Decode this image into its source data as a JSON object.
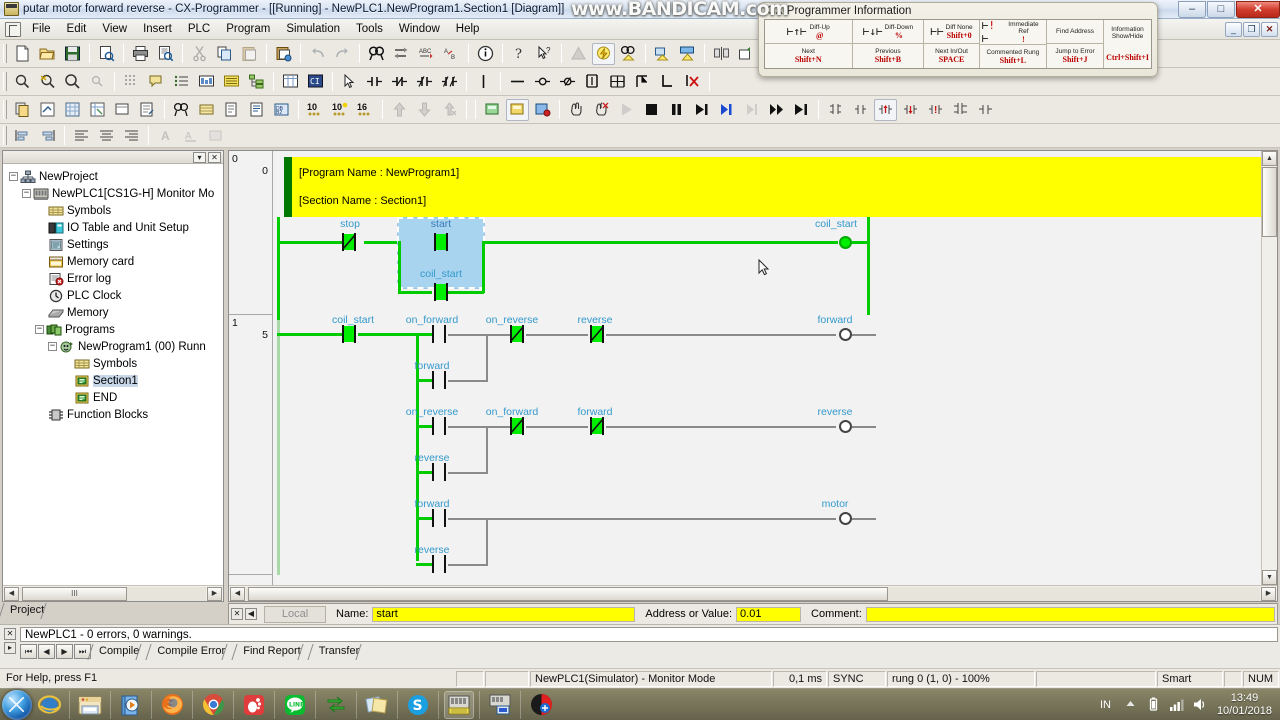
{
  "window": {
    "title": "putar motor forward reverse - CX-Programmer - [[Running] - NewPLC1.NewProgram1.Section1 [Diagram]]",
    "watermark": "www.BANDICAM.com",
    "minimize": "–",
    "maximize": "□",
    "close": "✕",
    "mdi_minimize": "_",
    "mdi_restore": "❐",
    "mdi_close": "✕"
  },
  "menu": {
    "items": [
      "File",
      "Edit",
      "View",
      "Insert",
      "PLC",
      "Program",
      "Simulation",
      "Tools",
      "Window",
      "Help"
    ]
  },
  "cx_info": {
    "title": "CX-Programmer Information",
    "top_row": [
      {
        "label": "Diff-Up",
        "key": "@"
      },
      {
        "label": "Diff-Down",
        "key": "%"
      },
      {
        "label": "Diff None",
        "key": "Shift+0"
      },
      {
        "label": "Immediate Ref",
        "key": "!"
      }
    ],
    "find_address_label": "Find Address",
    "bottom_row": [
      {
        "label": "Next",
        "key": "Shift+N"
      },
      {
        "label": "Previous",
        "key": "Shift+B"
      },
      {
        "label": "Next In/Out",
        "key": "SPACE"
      },
      {
        "label": "Commented Rung",
        "key": "Shift+L"
      },
      {
        "label": "Jump to Error",
        "key": "Shift+J"
      }
    ],
    "info_label_1": "Information",
    "info_label_2": "Show/Hide",
    "info_key": "Ctrl+Shift+I"
  },
  "project_tree": {
    "caption_buttons": [
      "▾",
      "✕"
    ],
    "nodes": [
      {
        "label": "NewProject",
        "depth": 0,
        "expander": "−",
        "icon": "project-icon",
        "selected": false
      },
      {
        "label": "NewPLC1[CS1G-H] Monitor Mo",
        "depth": 1,
        "expander": "−",
        "icon": "plc-icon",
        "selected": false
      },
      {
        "label": "Symbols",
        "depth": 2,
        "expander": "",
        "icon": "symbols-icon",
        "selected": false
      },
      {
        "label": "IO Table and Unit Setup",
        "depth": 2,
        "expander": "",
        "icon": "iotable-icon",
        "selected": false
      },
      {
        "label": "Settings",
        "depth": 2,
        "expander": "",
        "icon": "settings-icon",
        "selected": false
      },
      {
        "label": "Memory card",
        "depth": 2,
        "expander": "",
        "icon": "memorycard-icon",
        "selected": false
      },
      {
        "label": "Error log",
        "depth": 2,
        "expander": "",
        "icon": "errorlog-icon",
        "selected": false
      },
      {
        "label": "PLC Clock",
        "depth": 2,
        "expander": "",
        "icon": "clock-icon",
        "selected": false
      },
      {
        "label": "Memory",
        "depth": 2,
        "expander": "",
        "icon": "memory-icon",
        "selected": false
      },
      {
        "label": "Programs",
        "depth": 2,
        "expander": "−",
        "icon": "programs-icon",
        "selected": false
      },
      {
        "label": "NewProgram1 (00) Runn",
        "depth": 3,
        "expander": "−",
        "icon": "program-icon",
        "selected": false
      },
      {
        "label": "Symbols",
        "depth": 4,
        "expander": "",
        "icon": "symbols-icon",
        "selected": false
      },
      {
        "label": "Section1",
        "depth": 4,
        "expander": "",
        "icon": "section-icon",
        "selected": true
      },
      {
        "label": "END",
        "depth": 4,
        "expander": "",
        "icon": "section-icon",
        "selected": false
      },
      {
        "label": "Function Blocks",
        "depth": 2,
        "expander": "",
        "icon": "functionblock-icon",
        "selected": false
      }
    ],
    "tab_label": "Project",
    "scroll_thumb": "III"
  },
  "ladder": {
    "rungs": [
      {
        "number": "0",
        "address": "0"
      },
      {
        "number": "1",
        "address": "5"
      }
    ],
    "comment_lines": [
      "[Program Name : NewProgram1]",
      "[Section Name : Section1]"
    ],
    "rung0": {
      "contacts": [
        {
          "name": "stop",
          "type": "nc",
          "energized": true
        },
        {
          "name": "start",
          "type": "no",
          "energized": true,
          "selected": true
        }
      ],
      "branch": {
        "name": "coil_start",
        "type": "no",
        "energized": true
      },
      "output": {
        "name": "coil_start",
        "energized": true
      }
    },
    "rung1": {
      "lead": {
        "name": "coil_start",
        "type": "no",
        "energized": true
      },
      "lines": [
        {
          "or_inputs": [
            {
              "name": "on_forward",
              "type": "no",
              "energized": false
            },
            {
              "name": "forward",
              "type": "no",
              "energized": false
            }
          ],
          "series": [
            {
              "name": "on_reverse",
              "type": "nc",
              "energized": true
            },
            {
              "name": "reverse",
              "type": "nc",
              "energized": true
            }
          ],
          "output": {
            "name": "forward",
            "energized": false
          }
        },
        {
          "or_inputs": [
            {
              "name": "on_reverse",
              "type": "no",
              "energized": false
            },
            {
              "name": "reverse",
              "type": "no",
              "energized": false
            }
          ],
          "series": [
            {
              "name": "on_forward",
              "type": "nc",
              "energized": true
            },
            {
              "name": "forward",
              "type": "nc",
              "energized": true
            }
          ],
          "output": {
            "name": "reverse",
            "energized": false
          }
        },
        {
          "or_inputs": [
            {
              "name": "forward",
              "type": "no",
              "energized": false
            },
            {
              "name": "reverse",
              "type": "no",
              "energized": false
            }
          ],
          "series": [],
          "output": {
            "name": "motor",
            "energized": false
          }
        }
      ]
    }
  },
  "symbol_bar": {
    "close_btn": "✕",
    "grip_btn": "◀",
    "scope": "Local",
    "name_label": "Name:",
    "name_value": "start",
    "address_label": "Address or Value:",
    "address_value": "0.01",
    "comment_label": "Comment:",
    "comment_value": ""
  },
  "output_panel": {
    "close_btn": "✕",
    "grip_btn": "▸",
    "message": "NewPLC1 - 0 errors, 0 warnings.",
    "nav": [
      "⏮",
      "◀",
      "▶",
      "⏭"
    ],
    "tabs": [
      "Compile",
      "Compile Error",
      "Find Report",
      "Transfer"
    ],
    "active_tab": "Compile"
  },
  "status_bar": {
    "help": "For Help, press F1",
    "cells": [
      "",
      "",
      "NewPLC1(Simulator) - Monitor Mode",
      "0,1 ms",
      "SYNC",
      "rung 0 (1, 0)  - 100%",
      "",
      "Smart",
      "",
      "NUM"
    ]
  },
  "taskbar": {
    "apps": [
      {
        "name": "internet-explorer",
        "active": false
      },
      {
        "name": "file-explorer",
        "active": false
      },
      {
        "name": "media-player",
        "active": false
      },
      {
        "name": "firefox",
        "active": false
      },
      {
        "name": "chrome",
        "active": false
      },
      {
        "name": "gnome-foot",
        "active": false
      },
      {
        "name": "line",
        "active": false
      },
      {
        "name": "sync-tool",
        "active": false
      },
      {
        "name": "sticky-notes",
        "active": false
      },
      {
        "name": "skype",
        "active": false
      },
      {
        "name": "cx-programmer",
        "active": true
      },
      {
        "name": "cx-simulator",
        "active": false
      },
      {
        "name": "bandicam",
        "active": false
      }
    ],
    "language": "IN",
    "time": "13:49",
    "date": "10/01/2018"
  }
}
